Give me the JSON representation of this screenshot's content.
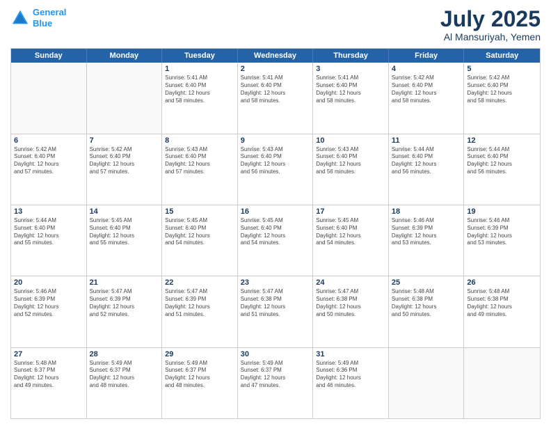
{
  "logo": {
    "line1": "General",
    "line2": "Blue"
  },
  "title": "July 2025",
  "location": "Al Mansuriyah, Yemen",
  "days": [
    "Sunday",
    "Monday",
    "Tuesday",
    "Wednesday",
    "Thursday",
    "Friday",
    "Saturday"
  ],
  "weeks": [
    [
      {
        "day": "",
        "info": ""
      },
      {
        "day": "",
        "info": ""
      },
      {
        "day": "1",
        "info": "Sunrise: 5:41 AM\nSunset: 6:40 PM\nDaylight: 12 hours\nand 58 minutes."
      },
      {
        "day": "2",
        "info": "Sunrise: 5:41 AM\nSunset: 6:40 PM\nDaylight: 12 hours\nand 58 minutes."
      },
      {
        "day": "3",
        "info": "Sunrise: 5:41 AM\nSunset: 6:40 PM\nDaylight: 12 hours\nand 58 minutes."
      },
      {
        "day": "4",
        "info": "Sunrise: 5:42 AM\nSunset: 6:40 PM\nDaylight: 12 hours\nand 58 minutes."
      },
      {
        "day": "5",
        "info": "Sunrise: 5:42 AM\nSunset: 6:40 PM\nDaylight: 12 hours\nand 58 minutes."
      }
    ],
    [
      {
        "day": "6",
        "info": "Sunrise: 5:42 AM\nSunset: 6:40 PM\nDaylight: 12 hours\nand 57 minutes."
      },
      {
        "day": "7",
        "info": "Sunrise: 5:42 AM\nSunset: 6:40 PM\nDaylight: 12 hours\nand 57 minutes."
      },
      {
        "day": "8",
        "info": "Sunrise: 5:43 AM\nSunset: 6:40 PM\nDaylight: 12 hours\nand 57 minutes."
      },
      {
        "day": "9",
        "info": "Sunrise: 5:43 AM\nSunset: 6:40 PM\nDaylight: 12 hours\nand 56 minutes."
      },
      {
        "day": "10",
        "info": "Sunrise: 5:43 AM\nSunset: 6:40 PM\nDaylight: 12 hours\nand 56 minutes."
      },
      {
        "day": "11",
        "info": "Sunrise: 5:44 AM\nSunset: 6:40 PM\nDaylight: 12 hours\nand 56 minutes."
      },
      {
        "day": "12",
        "info": "Sunrise: 5:44 AM\nSunset: 6:40 PM\nDaylight: 12 hours\nand 56 minutes."
      }
    ],
    [
      {
        "day": "13",
        "info": "Sunrise: 5:44 AM\nSunset: 6:40 PM\nDaylight: 12 hours\nand 55 minutes."
      },
      {
        "day": "14",
        "info": "Sunrise: 5:45 AM\nSunset: 6:40 PM\nDaylight: 12 hours\nand 55 minutes."
      },
      {
        "day": "15",
        "info": "Sunrise: 5:45 AM\nSunset: 6:40 PM\nDaylight: 12 hours\nand 54 minutes."
      },
      {
        "day": "16",
        "info": "Sunrise: 5:45 AM\nSunset: 6:40 PM\nDaylight: 12 hours\nand 54 minutes."
      },
      {
        "day": "17",
        "info": "Sunrise: 5:45 AM\nSunset: 6:40 PM\nDaylight: 12 hours\nand 54 minutes."
      },
      {
        "day": "18",
        "info": "Sunrise: 5:46 AM\nSunset: 6:39 PM\nDaylight: 12 hours\nand 53 minutes."
      },
      {
        "day": "19",
        "info": "Sunrise: 5:46 AM\nSunset: 6:39 PM\nDaylight: 12 hours\nand 53 minutes."
      }
    ],
    [
      {
        "day": "20",
        "info": "Sunrise: 5:46 AM\nSunset: 6:39 PM\nDaylight: 12 hours\nand 52 minutes."
      },
      {
        "day": "21",
        "info": "Sunrise: 5:47 AM\nSunset: 6:39 PM\nDaylight: 12 hours\nand 52 minutes."
      },
      {
        "day": "22",
        "info": "Sunrise: 5:47 AM\nSunset: 6:39 PM\nDaylight: 12 hours\nand 51 minutes."
      },
      {
        "day": "23",
        "info": "Sunrise: 5:47 AM\nSunset: 6:38 PM\nDaylight: 12 hours\nand 51 minutes."
      },
      {
        "day": "24",
        "info": "Sunrise: 5:47 AM\nSunset: 6:38 PM\nDaylight: 12 hours\nand 50 minutes."
      },
      {
        "day": "25",
        "info": "Sunrise: 5:48 AM\nSunset: 6:38 PM\nDaylight: 12 hours\nand 50 minutes."
      },
      {
        "day": "26",
        "info": "Sunrise: 5:48 AM\nSunset: 6:38 PM\nDaylight: 12 hours\nand 49 minutes."
      }
    ],
    [
      {
        "day": "27",
        "info": "Sunrise: 5:48 AM\nSunset: 6:37 PM\nDaylight: 12 hours\nand 49 minutes."
      },
      {
        "day": "28",
        "info": "Sunrise: 5:49 AM\nSunset: 6:37 PM\nDaylight: 12 hours\nand 48 minutes."
      },
      {
        "day": "29",
        "info": "Sunrise: 5:49 AM\nSunset: 6:37 PM\nDaylight: 12 hours\nand 48 minutes."
      },
      {
        "day": "30",
        "info": "Sunrise: 5:49 AM\nSunset: 6:37 PM\nDaylight: 12 hours\nand 47 minutes."
      },
      {
        "day": "31",
        "info": "Sunrise: 5:49 AM\nSunset: 6:36 PM\nDaylight: 12 hours\nand 46 minutes."
      },
      {
        "day": "",
        "info": ""
      },
      {
        "day": "",
        "info": ""
      }
    ]
  ]
}
